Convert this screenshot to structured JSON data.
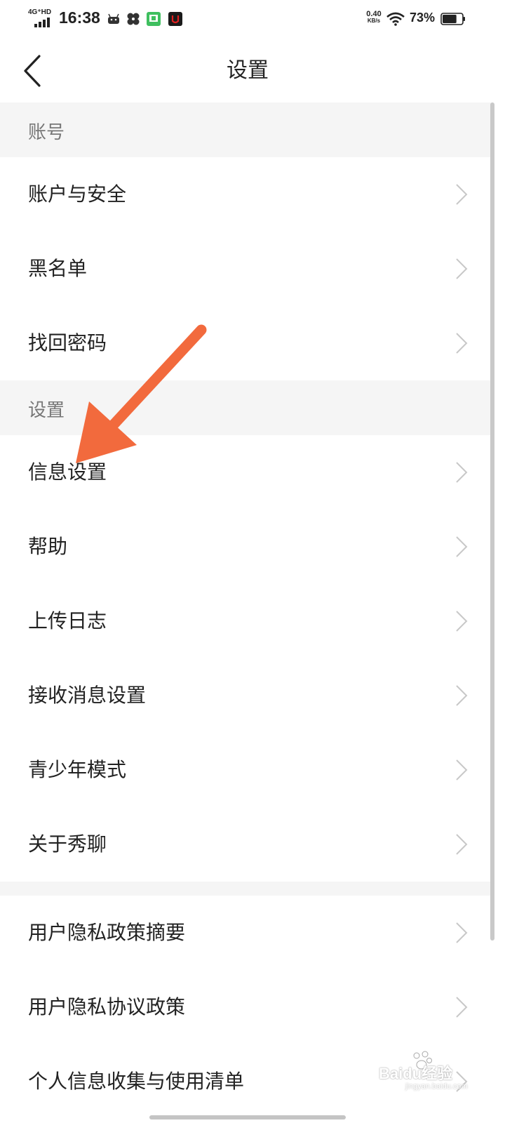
{
  "status_bar": {
    "network": "4G⁺HD",
    "time": "16:38",
    "net_speed_value": "0.40",
    "net_speed_unit": "KB/s",
    "battery_percent": "73%",
    "battery_level": 0.73,
    "app_icons": [
      "android-icon",
      "pinwheel-icon",
      "green-app-icon",
      "red-app-icon"
    ]
  },
  "nav": {
    "title": "设置",
    "back_icon": "chevron-left-icon"
  },
  "sections": [
    {
      "header": "账号",
      "items": [
        {
          "label": "账户与安全"
        },
        {
          "label": "黑名单"
        },
        {
          "label": "找回密码"
        }
      ]
    },
    {
      "header": "设置",
      "items": [
        {
          "label": "信息设置"
        },
        {
          "label": "帮助"
        },
        {
          "label": "上传日志"
        },
        {
          "label": "接收消息设置"
        },
        {
          "label": "青少年模式"
        },
        {
          "label": "关于秀聊"
        }
      ]
    },
    {
      "header": "",
      "items": [
        {
          "label": "用户隐私政策摘要"
        },
        {
          "label": "用户隐私协议政策"
        },
        {
          "label": "个人信息收集与使用清单"
        }
      ]
    }
  ],
  "annotation": {
    "type": "arrow",
    "color": "#f26a3d",
    "points_to": "信息设置"
  },
  "watermark": {
    "text": "Baidu经验",
    "sub": "jingyan.baidu.com"
  },
  "colors": {
    "section_bg": "#f5f5f5",
    "header_text": "#777777",
    "item_text": "#222222",
    "chevron": "#c8c8c8"
  }
}
